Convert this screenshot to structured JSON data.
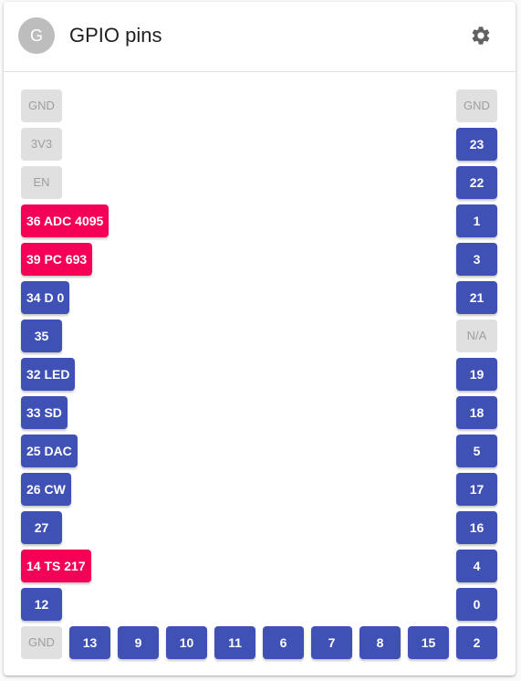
{
  "header": {
    "avatar_letter": "G",
    "title": "GPIO pins",
    "settings_icon": "gear-icon"
  },
  "colors": {
    "gpio": "#3f51b5",
    "active": "#f50057",
    "disabled": "#e0e0e0"
  },
  "left_pins": [
    {
      "label": "GND",
      "state": "disabled"
    },
    {
      "label": "3V3",
      "state": "disabled"
    },
    {
      "label": "EN",
      "state": "disabled"
    },
    {
      "label": "36 ADC 4095",
      "state": "active"
    },
    {
      "label": "39 PC 693",
      "state": "active"
    },
    {
      "label": "34 D 0",
      "state": "gpio"
    },
    {
      "label": "35",
      "state": "gpio"
    },
    {
      "label": "32 LED",
      "state": "gpio"
    },
    {
      "label": "33 SD",
      "state": "gpio"
    },
    {
      "label": "25 DAC",
      "state": "gpio"
    },
    {
      "label": "26 CW",
      "state": "gpio"
    },
    {
      "label": "27",
      "state": "gpio"
    },
    {
      "label": "14 TS 217",
      "state": "active"
    },
    {
      "label": "12",
      "state": "gpio"
    }
  ],
  "right_pins": [
    {
      "label": "GND",
      "state": "disabled"
    },
    {
      "label": "23",
      "state": "gpio"
    },
    {
      "label": "22",
      "state": "gpio"
    },
    {
      "label": "1",
      "state": "gpio"
    },
    {
      "label": "3",
      "state": "gpio"
    },
    {
      "label": "21",
      "state": "gpio"
    },
    {
      "label": "N/A",
      "state": "disabled"
    },
    {
      "label": "19",
      "state": "gpio"
    },
    {
      "label": "18",
      "state": "gpio"
    },
    {
      "label": "5",
      "state": "gpio"
    },
    {
      "label": "17",
      "state": "gpio"
    },
    {
      "label": "16",
      "state": "gpio"
    },
    {
      "label": "4",
      "state": "gpio"
    },
    {
      "label": "0",
      "state": "gpio"
    }
  ],
  "bottom_pins": [
    {
      "label": "GND",
      "state": "disabled"
    },
    {
      "label": "13",
      "state": "gpio"
    },
    {
      "label": "9",
      "state": "gpio"
    },
    {
      "label": "10",
      "state": "gpio"
    },
    {
      "label": "11",
      "state": "gpio"
    },
    {
      "label": "6",
      "state": "gpio"
    },
    {
      "label": "7",
      "state": "gpio"
    },
    {
      "label": "8",
      "state": "gpio"
    },
    {
      "label": "15",
      "state": "gpio"
    },
    {
      "label": "2",
      "state": "gpio"
    }
  ]
}
